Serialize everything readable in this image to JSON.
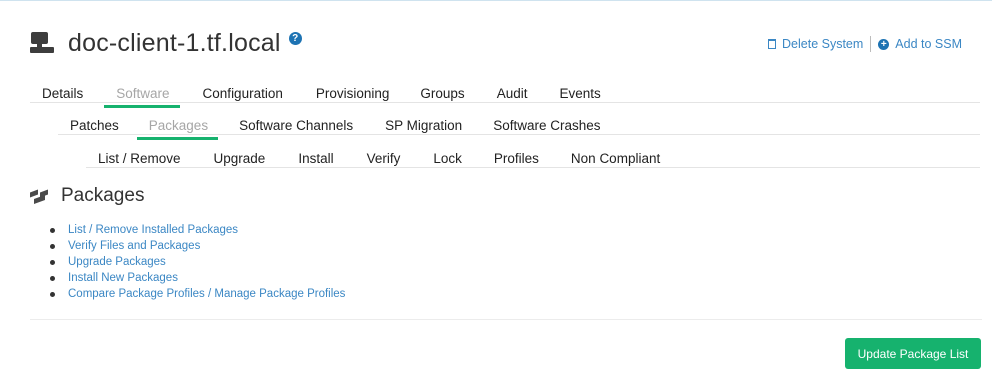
{
  "system": {
    "title": "doc-client-1.tf.local",
    "help_glyph": "?",
    "actions": {
      "delete_label": "Delete System",
      "add_ssm_label": "Add to SSM"
    }
  },
  "tabs": {
    "primary": [
      "Details",
      "Software",
      "Configuration",
      "Provisioning",
      "Groups",
      "Audit",
      "Events"
    ],
    "primary_active": "Software",
    "secondary": [
      "Patches",
      "Packages",
      "Software Channels",
      "SP Migration",
      "Software Crashes"
    ],
    "secondary_active": "Packages",
    "tertiary": [
      "List / Remove",
      "Upgrade",
      "Install",
      "Verify",
      "Lock",
      "Profiles",
      "Non Compliant"
    ]
  },
  "section": {
    "title": "Packages",
    "links": [
      "List / Remove Installed Packages",
      "Verify Files and Packages",
      "Upgrade Packages",
      "Install New Packages",
      "Compare Package Profiles / Manage Package Profiles"
    ]
  },
  "footer": {
    "update_button": "Update Package List"
  },
  "colors": {
    "accent_green": "#16b26e",
    "link_blue": "#3b87c4",
    "inactive_tab": "#a6a6a6"
  }
}
